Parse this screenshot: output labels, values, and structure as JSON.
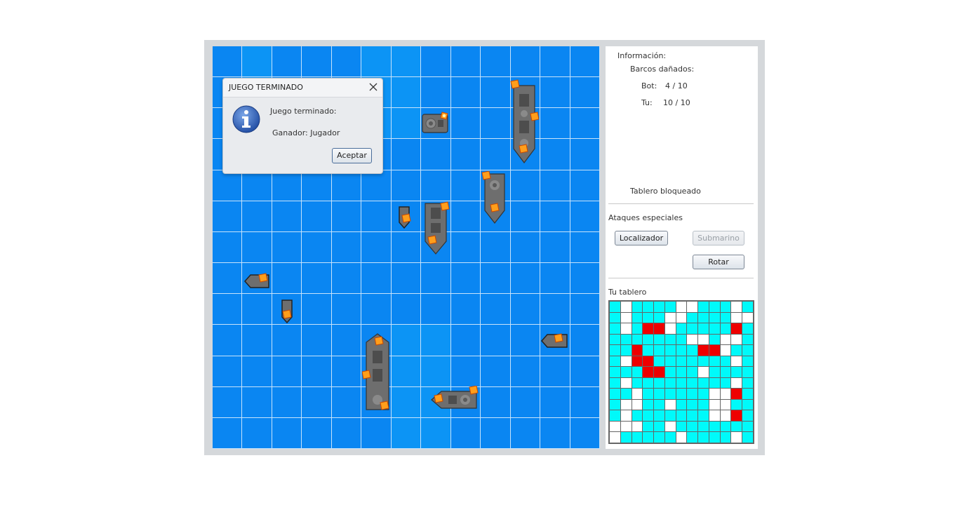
{
  "info": {
    "heading": "Información:",
    "damaged_heading": "Barcos dañados:",
    "bot_label": "Bot:",
    "bot_value": "4 / 10",
    "you_label": "Tu:",
    "you_value": "10 / 10",
    "board_status": "Tablero bloqueado"
  },
  "special_attacks": {
    "heading": "Ataques especiales",
    "locator_label": "Localizador",
    "submarine_label": "Submarino",
    "rotate_label": "Rotar"
  },
  "own_board": {
    "heading": "Tu tablero",
    "grid": [
      "cwccccwwcccwc",
      "cwcccwwccccww",
      "cwcrrwcccccrc",
      "cccccccwwcwwc",
      "ccrcccccrrwcc",
      "cwrrcccccccwc",
      "cccrrcccwcccc",
      "cwcccccccccwc",
      "ccwccccccwwrc",
      "cwwccwcccwwcc",
      "cwcccccccwwrc",
      "wwwccwccccccc",
      "wcccccwccccwc"
    ]
  },
  "dialog": {
    "title": "JUEGO TERMINADO",
    "message": "Juego terminado:",
    "winner": "Ganador:  Jugador",
    "ok_label": "Aceptar",
    "close_icon": "close-icon",
    "info_icon": "info-icon"
  },
  "colors": {
    "sea": "#0a86f2",
    "water_cell": "#00fafa",
    "hit_cell": "#ee0000",
    "empty_cell": "#ffffff"
  }
}
